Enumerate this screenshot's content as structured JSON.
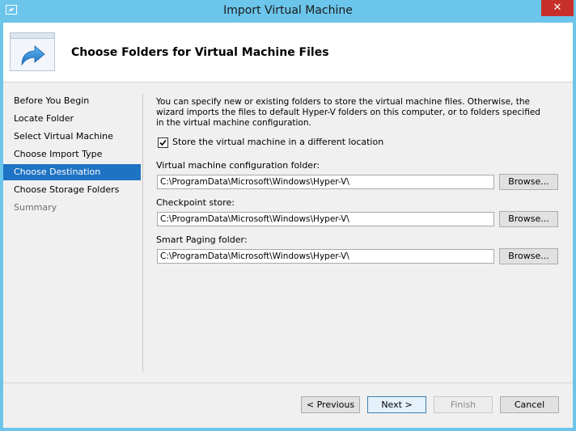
{
  "window": {
    "title": "Import Virtual Machine",
    "close_glyph": "✕"
  },
  "header": {
    "title": "Choose Folders for Virtual Machine Files",
    "icon": "arrow-forward-icon"
  },
  "steps": [
    {
      "label": "Before You Begin",
      "state": "normal"
    },
    {
      "label": "Locate Folder",
      "state": "normal"
    },
    {
      "label": "Select Virtual Machine",
      "state": "normal"
    },
    {
      "label": "Choose Import Type",
      "state": "normal"
    },
    {
      "label": "Choose Destination",
      "state": "active"
    },
    {
      "label": "Choose Storage Folders",
      "state": "normal"
    },
    {
      "label": "Summary",
      "state": "disabled"
    }
  ],
  "content": {
    "description": "You can specify new or existing folders to store the virtual machine files. Otherwise, the wizard imports the files to default Hyper-V folders on this computer, or to folders specified in the virtual machine configuration.",
    "store_checkbox": {
      "label": "Store the virtual machine in a different location",
      "checked": true
    },
    "config_folder": {
      "label": "Virtual machine configuration folder:",
      "value": "C:\\ProgramData\\Microsoft\\Windows\\Hyper-V\\",
      "browse": "Browse..."
    },
    "checkpoint_store": {
      "label": "Checkpoint store:",
      "value": "C:\\ProgramData\\Microsoft\\Windows\\Hyper-V\\",
      "browse": "Browse..."
    },
    "smart_paging": {
      "label": "Smart Paging folder:",
      "value": "C:\\ProgramData\\Microsoft\\Windows\\Hyper-V\\",
      "browse": "Browse..."
    }
  },
  "footer": {
    "previous": "< Previous",
    "next": "Next >",
    "finish": "Finish",
    "cancel": "Cancel"
  },
  "colors": {
    "accent": "#1e73c4",
    "titlebar": "#6cc5ea",
    "close": "#c7302a"
  }
}
